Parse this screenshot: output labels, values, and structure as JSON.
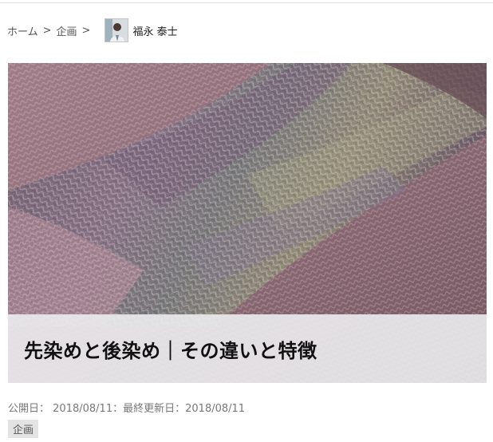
{
  "breadcrumb": {
    "home": "ホーム",
    "separator": ">",
    "category": "企画",
    "author_name": "福永 泰士"
  },
  "article": {
    "title": "先染めと後染め｜その違いと特徴",
    "hero_image_icon": "knitted-yarn-photo",
    "published_label": "公開日：",
    "published_date": "2018/08/11",
    "date_separator": "：",
    "updated_label": "最終更新日：",
    "updated_date": "2018/08/11",
    "category_tag": "企画"
  },
  "colors": {
    "title_band": "#ececee",
    "tag_background": "#e3e3e3",
    "meta_text": "#777777"
  }
}
